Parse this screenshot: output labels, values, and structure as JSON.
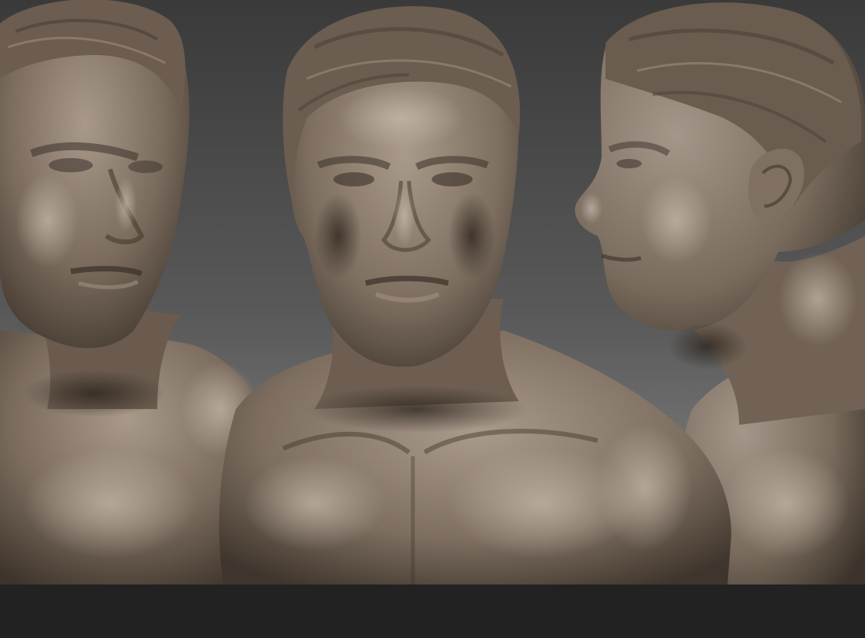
{
  "scene": {
    "description_free": true,
    "colors": {
      "background_top": "#3a3a3a",
      "background_bottom": "#8c8c8c",
      "base_strip": "#222222",
      "clay_light": "#a8998a",
      "clay_mid": "#7a6b5d",
      "clay_dark": "#3e342b"
    },
    "views": [
      {
        "name": "three-quarter-view"
      },
      {
        "name": "front-view"
      },
      {
        "name": "profile-view"
      }
    ]
  }
}
